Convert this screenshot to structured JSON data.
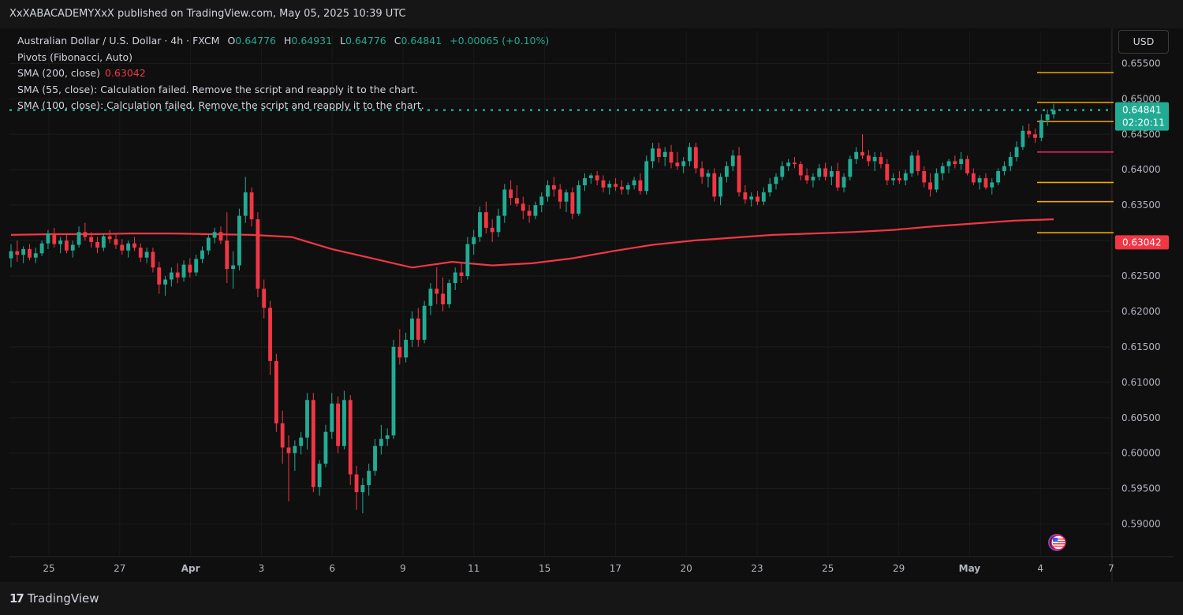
{
  "header": {
    "publisher_line": "XxXABACADEMYXxX published on TradingView.com, May 05, 2025 10:39 UTC"
  },
  "legend": {
    "symbol": "Australian Dollar / U.S. Dollar · 4h · FXCM",
    "o_label": "O",
    "o_value": "0.64776",
    "h_label": "H",
    "h_value": "0.64931",
    "l_label": "L",
    "l_value": "0.64776",
    "c_label": "C",
    "c_value": "0.64841",
    "change": "+0.00065 (+0.10%)",
    "pivots": "Pivots (Fibonacci, Auto)",
    "sma200_label": "SMA (200, close)",
    "sma200_value": "0.63042",
    "sma55": "SMA (55, close): Calculation failed. Remove the script and reapply it to the chart.",
    "sma100": "SMA (100, close): Calculation failed. Remove the script and reapply it to the chart."
  },
  "currency_button": "USD",
  "footer": {
    "brand": "TradingView",
    "mark": "17"
  },
  "colors": {
    "up": "#22ab94",
    "down": "#f23645",
    "sma": "#f23645",
    "pivot_orange": "#f7a600",
    "pivot_pink": "#e91e63",
    "price_line": "#22ab94"
  },
  "chart_data": {
    "type": "candlestick",
    "symbol": "AUDUSD",
    "timeframe": "4h",
    "y_ticks": [
      "0.65500",
      "0.65000",
      "0.64500",
      "0.64000",
      "0.63500",
      "0.63000",
      "0.62500",
      "0.62000",
      "0.61500",
      "0.61000",
      "0.60500",
      "0.60000",
      "0.59500",
      "0.59000"
    ],
    "ylim": [
      0.5855,
      0.6595
    ],
    "x_ticks": [
      "25",
      "27",
      "Apr",
      "3",
      "6",
      "9",
      "11",
      "15",
      "17",
      "20",
      "23",
      "25",
      "29",
      "May",
      "4",
      "7"
    ],
    "last_price": "0.64841",
    "countdown": "02:20:11",
    "sma200_last": "0.63042",
    "pivot_levels": [
      0.6537,
      0.6495,
      0.6468,
      0.6425,
      0.6382,
      0.6355,
      0.6311
    ],
    "sma200": [
      0.6308,
      0.6309,
      0.6309,
      0.631,
      0.631,
      0.6309,
      0.6308,
      0.6305,
      0.6288,
      0.6275,
      0.6262,
      0.627,
      0.6265,
      0.6268,
      0.6275,
      0.6285,
      0.6294,
      0.63,
      0.6304,
      0.6308,
      0.631,
      0.6312,
      0.6315,
      0.632,
      0.6324,
      0.6328,
      0.633
    ],
    "candles": [
      {
        "o": 0.6275,
        "h": 0.6295,
        "l": 0.6262,
        "c": 0.6285
      },
      {
        "o": 0.6285,
        "h": 0.63,
        "l": 0.627,
        "c": 0.628
      },
      {
        "o": 0.628,
        "h": 0.6292,
        "l": 0.6268,
        "c": 0.6288
      },
      {
        "o": 0.6288,
        "h": 0.6295,
        "l": 0.6272,
        "c": 0.6276
      },
      {
        "o": 0.6276,
        "h": 0.629,
        "l": 0.6268,
        "c": 0.6282
      },
      {
        "o": 0.6282,
        "h": 0.63,
        "l": 0.6278,
        "c": 0.6296
      },
      {
        "o": 0.6296,
        "h": 0.6315,
        "l": 0.6288,
        "c": 0.631
      },
      {
        "o": 0.631,
        "h": 0.6318,
        "l": 0.629,
        "c": 0.6295
      },
      {
        "o": 0.6295,
        "h": 0.6305,
        "l": 0.6282,
        "c": 0.63
      },
      {
        "o": 0.63,
        "h": 0.631,
        "l": 0.6282,
        "c": 0.6286
      },
      {
        "o": 0.6286,
        "h": 0.63,
        "l": 0.6276,
        "c": 0.6294
      },
      {
        "o": 0.6294,
        "h": 0.632,
        "l": 0.629,
        "c": 0.6312
      },
      {
        "o": 0.6312,
        "h": 0.6325,
        "l": 0.63,
        "c": 0.6305
      },
      {
        "o": 0.6305,
        "h": 0.6312,
        "l": 0.629,
        "c": 0.6298
      },
      {
        "o": 0.6298,
        "h": 0.6305,
        "l": 0.6282,
        "c": 0.629
      },
      {
        "o": 0.629,
        "h": 0.631,
        "l": 0.6285,
        "c": 0.6306
      },
      {
        "o": 0.6306,
        "h": 0.6315,
        "l": 0.6296,
        "c": 0.6302
      },
      {
        "o": 0.6302,
        "h": 0.631,
        "l": 0.6288,
        "c": 0.6294
      },
      {
        "o": 0.6294,
        "h": 0.6302,
        "l": 0.628,
        "c": 0.6286
      },
      {
        "o": 0.6286,
        "h": 0.63,
        "l": 0.6276,
        "c": 0.6296
      },
      {
        "o": 0.6296,
        "h": 0.6305,
        "l": 0.6285,
        "c": 0.629
      },
      {
        "o": 0.629,
        "h": 0.6296,
        "l": 0.627,
        "c": 0.6276
      },
      {
        "o": 0.6276,
        "h": 0.629,
        "l": 0.6268,
        "c": 0.6284
      },
      {
        "o": 0.6284,
        "h": 0.629,
        "l": 0.6255,
        "c": 0.6262
      },
      {
        "o": 0.6262,
        "h": 0.627,
        "l": 0.6225,
        "c": 0.6238
      },
      {
        "o": 0.6238,
        "h": 0.625,
        "l": 0.6222,
        "c": 0.6245
      },
      {
        "o": 0.6245,
        "h": 0.6262,
        "l": 0.6235,
        "c": 0.6255
      },
      {
        "o": 0.6255,
        "h": 0.6268,
        "l": 0.624,
        "c": 0.6248
      },
      {
        "o": 0.6248,
        "h": 0.6272,
        "l": 0.6242,
        "c": 0.6266
      },
      {
        "o": 0.6266,
        "h": 0.6275,
        "l": 0.6248,
        "c": 0.6255
      },
      {
        "o": 0.6255,
        "h": 0.628,
        "l": 0.625,
        "c": 0.6274
      },
      {
        "o": 0.6274,
        "h": 0.6292,
        "l": 0.6268,
        "c": 0.6286
      },
      {
        "o": 0.6286,
        "h": 0.631,
        "l": 0.628,
        "c": 0.6304
      },
      {
        "o": 0.6304,
        "h": 0.6318,
        "l": 0.6296,
        "c": 0.6312
      },
      {
        "o": 0.6312,
        "h": 0.632,
        "l": 0.6295,
        "c": 0.63
      },
      {
        "o": 0.63,
        "h": 0.634,
        "l": 0.624,
        "c": 0.626
      },
      {
        "o": 0.626,
        "h": 0.6285,
        "l": 0.6232,
        "c": 0.6265
      },
      {
        "o": 0.6265,
        "h": 0.6345,
        "l": 0.6258,
        "c": 0.6335
      },
      {
        "o": 0.6335,
        "h": 0.639,
        "l": 0.6325,
        "c": 0.6368
      },
      {
        "o": 0.6368,
        "h": 0.6375,
        "l": 0.632,
        "c": 0.633
      },
      {
        "o": 0.633,
        "h": 0.634,
        "l": 0.622,
        "c": 0.6232
      },
      {
        "o": 0.6232,
        "h": 0.6245,
        "l": 0.619,
        "c": 0.6205
      },
      {
        "o": 0.6205,
        "h": 0.6215,
        "l": 0.611,
        "c": 0.613
      },
      {
        "o": 0.613,
        "h": 0.614,
        "l": 0.603,
        "c": 0.6042
      },
      {
        "o": 0.6042,
        "h": 0.606,
        "l": 0.5985,
        "c": 0.6008
      },
      {
        "o": 0.6008,
        "h": 0.6025,
        "l": 0.5932,
        "c": 0.6
      },
      {
        "o": 0.6,
        "h": 0.6018,
        "l": 0.5975,
        "c": 0.601
      },
      {
        "o": 0.601,
        "h": 0.603,
        "l": 0.5998,
        "c": 0.6022
      },
      {
        "o": 0.6022,
        "h": 0.6085,
        "l": 0.6005,
        "c": 0.6075
      },
      {
        "o": 0.6075,
        "h": 0.6085,
        "l": 0.5945,
        "c": 0.5952
      },
      {
        "o": 0.5952,
        "h": 0.599,
        "l": 0.594,
        "c": 0.5985
      },
      {
        "o": 0.5985,
        "h": 0.604,
        "l": 0.598,
        "c": 0.603
      },
      {
        "o": 0.603,
        "h": 0.6085,
        "l": 0.602,
        "c": 0.607
      },
      {
        "o": 0.607,
        "h": 0.608,
        "l": 0.6,
        "c": 0.601
      },
      {
        "o": 0.601,
        "h": 0.6088,
        "l": 0.6005,
        "c": 0.6075
      },
      {
        "o": 0.6075,
        "h": 0.6082,
        "l": 0.5955,
        "c": 0.597
      },
      {
        "o": 0.597,
        "h": 0.5982,
        "l": 0.592,
        "c": 0.5945
      },
      {
        "o": 0.5945,
        "h": 0.5965,
        "l": 0.5915,
        "c": 0.5955
      },
      {
        "o": 0.5955,
        "h": 0.5985,
        "l": 0.594,
        "c": 0.5975
      },
      {
        "o": 0.5975,
        "h": 0.602,
        "l": 0.5968,
        "c": 0.601
      },
      {
        "o": 0.601,
        "h": 0.604,
        "l": 0.5998,
        "c": 0.602
      },
      {
        "o": 0.602,
        "h": 0.6035,
        "l": 0.601,
        "c": 0.6025
      },
      {
        "o": 0.6025,
        "h": 0.616,
        "l": 0.602,
        "c": 0.615
      },
      {
        "o": 0.615,
        "h": 0.6175,
        "l": 0.6125,
        "c": 0.6135
      },
      {
        "o": 0.6135,
        "h": 0.617,
        "l": 0.6128,
        "c": 0.616
      },
      {
        "o": 0.616,
        "h": 0.62,
        "l": 0.615,
        "c": 0.619
      },
      {
        "o": 0.619,
        "h": 0.6205,
        "l": 0.615,
        "c": 0.616
      },
      {
        "o": 0.616,
        "h": 0.6215,
        "l": 0.6155,
        "c": 0.6208
      },
      {
        "o": 0.6208,
        "h": 0.624,
        "l": 0.6195,
        "c": 0.6232
      },
      {
        "o": 0.6232,
        "h": 0.6262,
        "l": 0.621,
        "c": 0.6225
      },
      {
        "o": 0.6225,
        "h": 0.6248,
        "l": 0.62,
        "c": 0.621
      },
      {
        "o": 0.621,
        "h": 0.6245,
        "l": 0.6205,
        "c": 0.624
      },
      {
        "o": 0.624,
        "h": 0.6262,
        "l": 0.623,
        "c": 0.6255
      },
      {
        "o": 0.6255,
        "h": 0.627,
        "l": 0.624,
        "c": 0.625
      },
      {
        "o": 0.625,
        "h": 0.6305,
        "l": 0.6245,
        "c": 0.6295
      },
      {
        "o": 0.6295,
        "h": 0.6315,
        "l": 0.628,
        "c": 0.6305
      },
      {
        "o": 0.6305,
        "h": 0.6348,
        "l": 0.6298,
        "c": 0.634
      },
      {
        "o": 0.634,
        "h": 0.6355,
        "l": 0.631,
        "c": 0.6318
      },
      {
        "o": 0.6318,
        "h": 0.633,
        "l": 0.6298,
        "c": 0.6312
      },
      {
        "o": 0.6312,
        "h": 0.6345,
        "l": 0.6305,
        "c": 0.6335
      },
      {
        "o": 0.6335,
        "h": 0.638,
        "l": 0.6325,
        "c": 0.6372
      },
      {
        "o": 0.6372,
        "h": 0.6385,
        "l": 0.635,
        "c": 0.636
      },
      {
        "o": 0.636,
        "h": 0.6378,
        "l": 0.6348,
        "c": 0.6352
      },
      {
        "o": 0.6352,
        "h": 0.6362,
        "l": 0.633,
        "c": 0.6342
      },
      {
        "o": 0.6342,
        "h": 0.635,
        "l": 0.6325,
        "c": 0.6335
      },
      {
        "o": 0.6335,
        "h": 0.6355,
        "l": 0.633,
        "c": 0.635
      },
      {
        "o": 0.635,
        "h": 0.6368,
        "l": 0.634,
        "c": 0.6362
      },
      {
        "o": 0.6362,
        "h": 0.6385,
        "l": 0.6355,
        "c": 0.6378
      },
      {
        "o": 0.6378,
        "h": 0.639,
        "l": 0.6362,
        "c": 0.6372
      },
      {
        "o": 0.6372,
        "h": 0.638,
        "l": 0.6345,
        "c": 0.6355
      },
      {
        "o": 0.6355,
        "h": 0.6372,
        "l": 0.634,
        "c": 0.6368
      },
      {
        "o": 0.6368,
        "h": 0.6375,
        "l": 0.633,
        "c": 0.6338
      },
      {
        "o": 0.6338,
        "h": 0.6385,
        "l": 0.6335,
        "c": 0.6378
      },
      {
        "o": 0.6378,
        "h": 0.6395,
        "l": 0.637,
        "c": 0.6388
      },
      {
        "o": 0.6388,
        "h": 0.6395,
        "l": 0.638,
        "c": 0.6392
      },
      {
        "o": 0.6392,
        "h": 0.6398,
        "l": 0.6378,
        "c": 0.6385
      },
      {
        "o": 0.6385,
        "h": 0.6392,
        "l": 0.6368,
        "c": 0.6375
      },
      {
        "o": 0.6375,
        "h": 0.6385,
        "l": 0.6365,
        "c": 0.638
      },
      {
        "o": 0.638,
        "h": 0.6388,
        "l": 0.637,
        "c": 0.6376
      },
      {
        "o": 0.6376,
        "h": 0.6385,
        "l": 0.6365,
        "c": 0.6372
      },
      {
        "o": 0.6372,
        "h": 0.6382,
        "l": 0.6365,
        "c": 0.6378
      },
      {
        "o": 0.6378,
        "h": 0.639,
        "l": 0.6372,
        "c": 0.6385
      },
      {
        "o": 0.6385,
        "h": 0.6395,
        "l": 0.6365,
        "c": 0.637
      },
      {
        "o": 0.637,
        "h": 0.642,
        "l": 0.6365,
        "c": 0.6412
      },
      {
        "o": 0.6412,
        "h": 0.6438,
        "l": 0.6402,
        "c": 0.643
      },
      {
        "o": 0.643,
        "h": 0.6438,
        "l": 0.641,
        "c": 0.6418
      },
      {
        "o": 0.6418,
        "h": 0.6432,
        "l": 0.6405,
        "c": 0.6425
      },
      {
        "o": 0.6425,
        "h": 0.6435,
        "l": 0.6402,
        "c": 0.641
      },
      {
        "o": 0.641,
        "h": 0.6425,
        "l": 0.64,
        "c": 0.6405
      },
      {
        "o": 0.6405,
        "h": 0.6418,
        "l": 0.6395,
        "c": 0.6412
      },
      {
        "o": 0.6412,
        "h": 0.6438,
        "l": 0.6405,
        "c": 0.6432
      },
      {
        "o": 0.6432,
        "h": 0.6438,
        "l": 0.6395,
        "c": 0.6402
      },
      {
        "o": 0.6402,
        "h": 0.6412,
        "l": 0.638,
        "c": 0.639
      },
      {
        "o": 0.639,
        "h": 0.64,
        "l": 0.6375,
        "c": 0.6395
      },
      {
        "o": 0.6395,
        "h": 0.6402,
        "l": 0.6355,
        "c": 0.6362
      },
      {
        "o": 0.6362,
        "h": 0.6395,
        "l": 0.635,
        "c": 0.639
      },
      {
        "o": 0.639,
        "h": 0.6412,
        "l": 0.6382,
        "c": 0.6405
      },
      {
        "o": 0.6405,
        "h": 0.6428,
        "l": 0.6398,
        "c": 0.642
      },
      {
        "o": 0.642,
        "h": 0.6432,
        "l": 0.6362,
        "c": 0.6368
      },
      {
        "o": 0.6368,
        "h": 0.6378,
        "l": 0.6352,
        "c": 0.6358
      },
      {
        "o": 0.6358,
        "h": 0.6368,
        "l": 0.6348,
        "c": 0.6362
      },
      {
        "o": 0.6362,
        "h": 0.637,
        "l": 0.635,
        "c": 0.6355
      },
      {
        "o": 0.6355,
        "h": 0.6375,
        "l": 0.635,
        "c": 0.6368
      },
      {
        "o": 0.6368,
        "h": 0.6388,
        "l": 0.6362,
        "c": 0.638
      },
      {
        "o": 0.638,
        "h": 0.6395,
        "l": 0.6372,
        "c": 0.639
      },
      {
        "o": 0.639,
        "h": 0.6412,
        "l": 0.6385,
        "c": 0.6405
      },
      {
        "o": 0.6405,
        "h": 0.6415,
        "l": 0.6398,
        "c": 0.641
      },
      {
        "o": 0.641,
        "h": 0.6418,
        "l": 0.6402,
        "c": 0.6408
      },
      {
        "o": 0.6408,
        "h": 0.6412,
        "l": 0.6385,
        "c": 0.6392
      },
      {
        "o": 0.6392,
        "h": 0.6402,
        "l": 0.638,
        "c": 0.6385
      },
      {
        "o": 0.6385,
        "h": 0.6395,
        "l": 0.6375,
        "c": 0.639
      },
      {
        "o": 0.639,
        "h": 0.6408,
        "l": 0.6385,
        "c": 0.6402
      },
      {
        "o": 0.6402,
        "h": 0.641,
        "l": 0.6385,
        "c": 0.639
      },
      {
        "o": 0.639,
        "h": 0.6405,
        "l": 0.6378,
        "c": 0.6398
      },
      {
        "o": 0.6398,
        "h": 0.641,
        "l": 0.637,
        "c": 0.6375
      },
      {
        "o": 0.6375,
        "h": 0.6395,
        "l": 0.6368,
        "c": 0.639
      },
      {
        "o": 0.639,
        "h": 0.642,
        "l": 0.6385,
        "c": 0.6415
      },
      {
        "o": 0.6415,
        "h": 0.6432,
        "l": 0.6408,
        "c": 0.6425
      },
      {
        "o": 0.6425,
        "h": 0.645,
        "l": 0.6415,
        "c": 0.642
      },
      {
        "o": 0.642,
        "h": 0.6428,
        "l": 0.6405,
        "c": 0.6412
      },
      {
        "o": 0.6412,
        "h": 0.6425,
        "l": 0.6398,
        "c": 0.6418
      },
      {
        "o": 0.6418,
        "h": 0.6425,
        "l": 0.6402,
        "c": 0.6408
      },
      {
        "o": 0.6408,
        "h": 0.6415,
        "l": 0.6378,
        "c": 0.6385
      },
      {
        "o": 0.6385,
        "h": 0.6395,
        "l": 0.6378,
        "c": 0.6388
      },
      {
        "o": 0.6388,
        "h": 0.6398,
        "l": 0.638,
        "c": 0.6385
      },
      {
        "o": 0.6385,
        "h": 0.64,
        "l": 0.6378,
        "c": 0.6395
      },
      {
        "o": 0.6395,
        "h": 0.6425,
        "l": 0.639,
        "c": 0.642
      },
      {
        "o": 0.642,
        "h": 0.6428,
        "l": 0.6392,
        "c": 0.6398
      },
      {
        "o": 0.6398,
        "h": 0.6405,
        "l": 0.6375,
        "c": 0.6382
      },
      {
        "o": 0.6382,
        "h": 0.6395,
        "l": 0.6362,
        "c": 0.6372
      },
      {
        "o": 0.6372,
        "h": 0.6402,
        "l": 0.6368,
        "c": 0.6395
      },
      {
        "o": 0.6395,
        "h": 0.641,
        "l": 0.6385,
        "c": 0.6405
      },
      {
        "o": 0.6405,
        "h": 0.6415,
        "l": 0.6395,
        "c": 0.6412
      },
      {
        "o": 0.6412,
        "h": 0.642,
        "l": 0.6402,
        "c": 0.6408
      },
      {
        "o": 0.6408,
        "h": 0.6425,
        "l": 0.64,
        "c": 0.6415
      },
      {
        "o": 0.6415,
        "h": 0.642,
        "l": 0.6392,
        "c": 0.6395
      },
      {
        "o": 0.6395,
        "h": 0.6402,
        "l": 0.6378,
        "c": 0.6382
      },
      {
        "o": 0.6382,
        "h": 0.6392,
        "l": 0.6372,
        "c": 0.6388
      },
      {
        "o": 0.6388,
        "h": 0.6395,
        "l": 0.6372,
        "c": 0.6375
      },
      {
        "o": 0.6375,
        "h": 0.6388,
        "l": 0.6365,
        "c": 0.6382
      },
      {
        "o": 0.6382,
        "h": 0.6402,
        "l": 0.6378,
        "c": 0.6398
      },
      {
        "o": 0.6398,
        "h": 0.6412,
        "l": 0.6392,
        "c": 0.6405
      },
      {
        "o": 0.6405,
        "h": 0.6425,
        "l": 0.6398,
        "c": 0.6418
      },
      {
        "o": 0.6418,
        "h": 0.644,
        "l": 0.6412,
        "c": 0.6432
      },
      {
        "o": 0.6432,
        "h": 0.6462,
        "l": 0.6428,
        "c": 0.6455
      },
      {
        "o": 0.6455,
        "h": 0.6465,
        "l": 0.6445,
        "c": 0.645
      },
      {
        "o": 0.645,
        "h": 0.6458,
        "l": 0.6438,
        "c": 0.6445
      },
      {
        "o": 0.6445,
        "h": 0.6478,
        "l": 0.644,
        "c": 0.647
      },
      {
        "o": 0.647,
        "h": 0.6485,
        "l": 0.6462,
        "c": 0.6478
      },
      {
        "o": 0.6478,
        "h": 0.6493,
        "l": 0.6472,
        "c": 0.6484
      }
    ]
  }
}
